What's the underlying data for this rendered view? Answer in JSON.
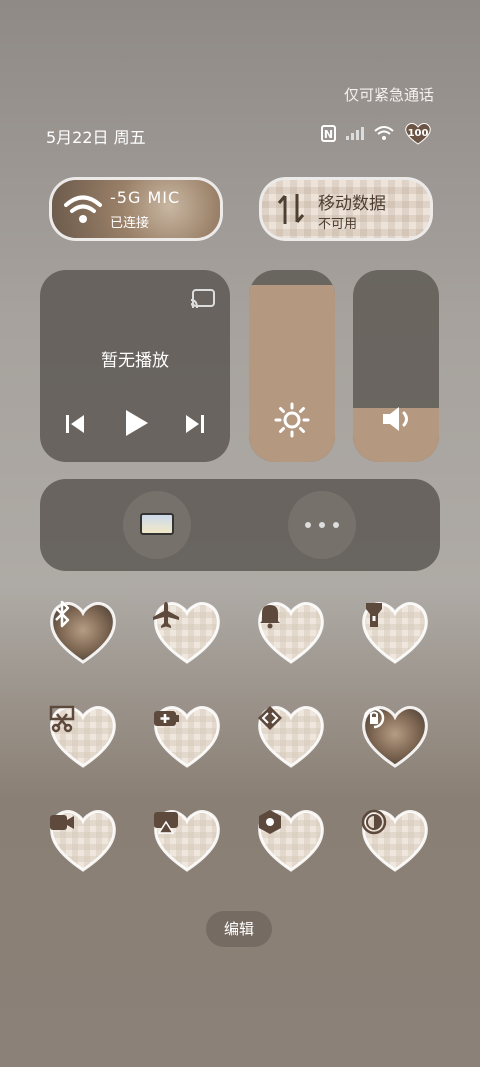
{
  "status_bar": {
    "emergency_text": "仅可紧急通话",
    "date_text": "5月22日 周五",
    "nfc_label": "N",
    "battery_text": "100"
  },
  "wifi_tile": {
    "name": "-5G MIC",
    "status": "已连接",
    "icon": "wifi-icon"
  },
  "data_tile": {
    "name": "移动数据",
    "status": "不可用",
    "icon": "data-arrows-icon"
  },
  "media": {
    "title": "暂无播放",
    "cast_icon": "cast-icon",
    "prev_icon": "skip-previous-icon",
    "play_icon": "play-icon",
    "next_icon": "skip-next-icon"
  },
  "brightness": {
    "level": 0.92,
    "icon": "sun-icon"
  },
  "volume": {
    "level": 0.28,
    "icon": "speaker-icon"
  },
  "bottom_card": {
    "left_icon": "screen-icon",
    "right_icon": "more-icon"
  },
  "toggles": [
    {
      "name": "bluetooth",
      "icon": "bluetooth-icon"
    },
    {
      "name": "airplane",
      "icon": "airplane-icon"
    },
    {
      "name": "ring",
      "icon": "bell-icon"
    },
    {
      "name": "flashlight",
      "icon": "flashlight-icon"
    },
    {
      "name": "screenshot",
      "icon": "scissors-icon"
    },
    {
      "name": "battery-saver",
      "icon": "battery-plus-icon"
    },
    {
      "name": "share",
      "icon": "share-arrows-icon"
    },
    {
      "name": "rotation-lock",
      "icon": "rotation-lock-icon"
    },
    {
      "name": "screen-record",
      "icon": "video-camera-icon"
    },
    {
      "name": "screen-cast",
      "icon": "airplay-icon"
    },
    {
      "name": "settings",
      "icon": "hexagon-settings-icon"
    },
    {
      "name": "eye-comfort",
      "icon": "contrast-icon"
    }
  ],
  "edit_label": "编辑"
}
